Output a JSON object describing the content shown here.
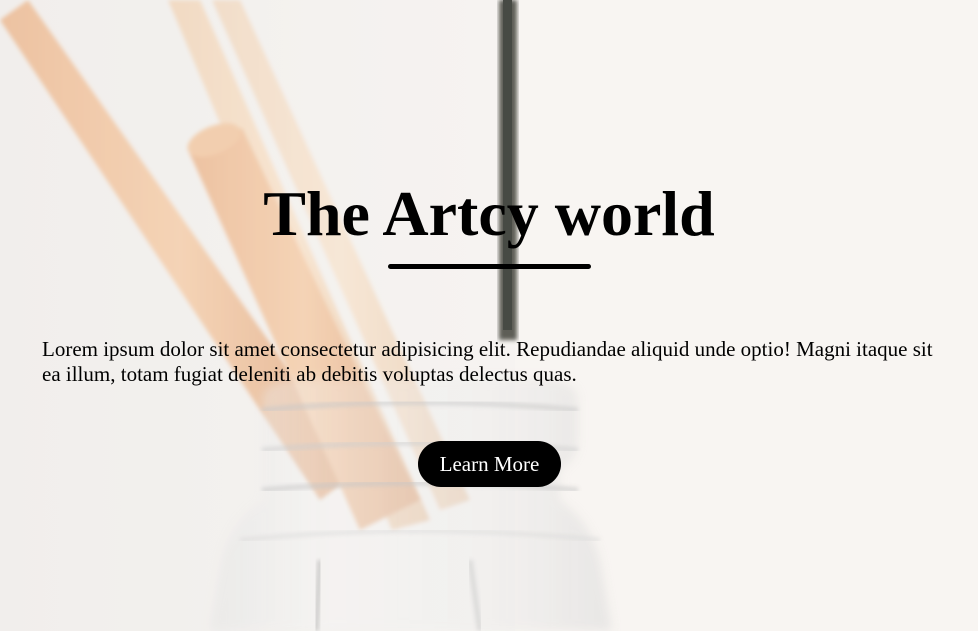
{
  "hero": {
    "title": "The Artcy world",
    "description": "Lorem ipsum dolor sit amet consectetur adipisicing elit. Repudiandae aliquid unde optio! Magni itaque sit ea illum, totam fugiat deleniti ab debitis voluptas delectus quas.",
    "cta_label": "Learn More"
  },
  "colors": {
    "text": "#000000",
    "button_bg": "#000000",
    "button_text": "#ffffff",
    "background": "#f2eeea"
  }
}
